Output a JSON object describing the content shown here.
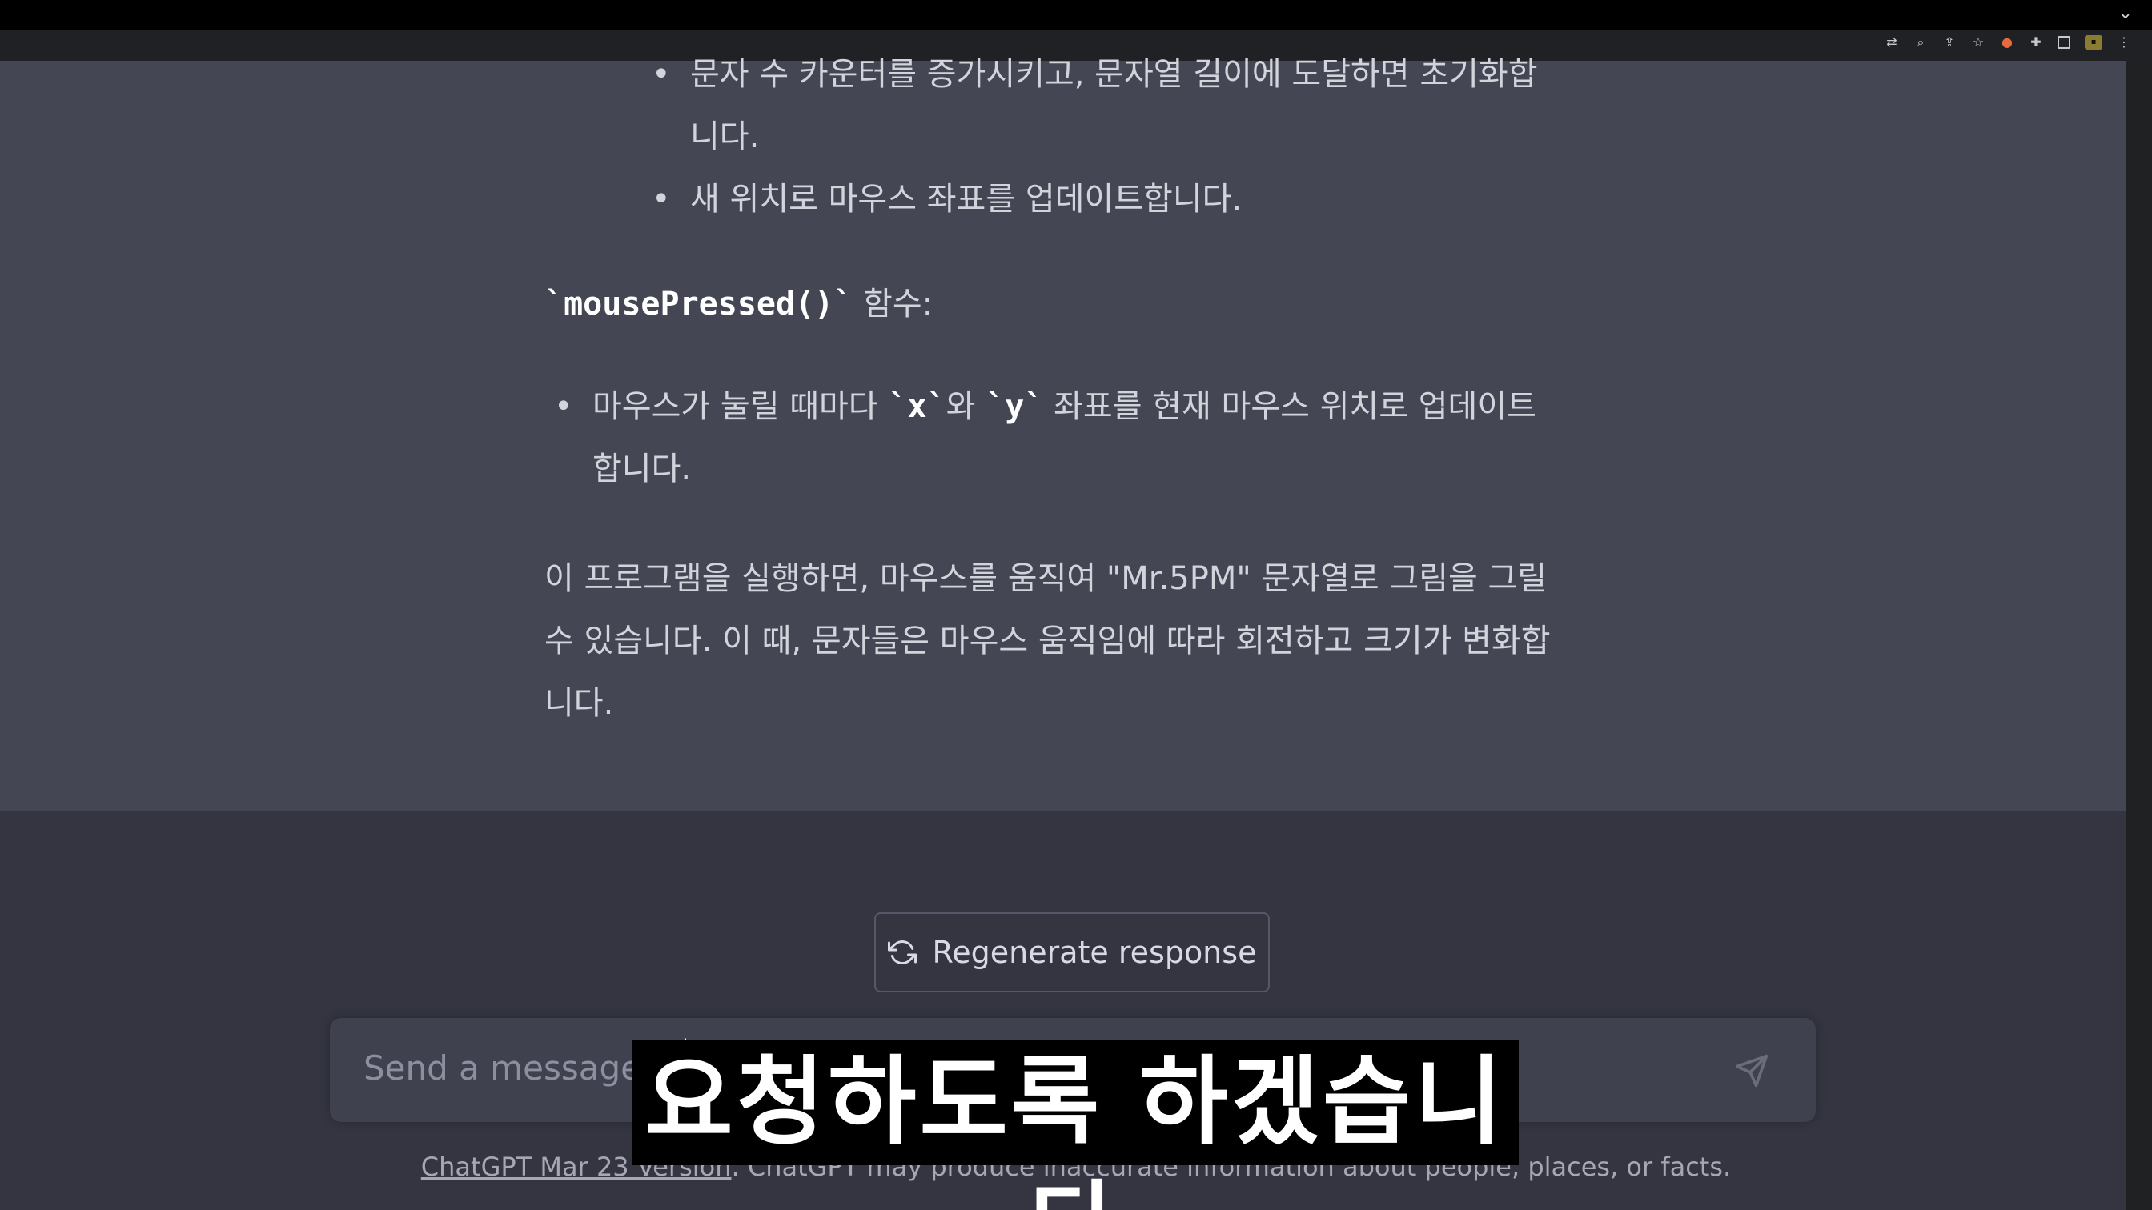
{
  "browser": {
    "menu_chevron": "⌄",
    "toolbar_icons": [
      "translate-icon",
      "zoom-icon",
      "share-icon",
      "bookmark-star-icon",
      "extension-orange-icon",
      "puzzle-extensions-icon",
      "sidepanel-icon",
      "profile-badge-icon",
      "menu-kebab-icon"
    ]
  },
  "assistant_message": {
    "list_a": [
      "문자 수 카운터를 증가시키고, 문자열 길이에 도달하면 초기화합니다.",
      "새 위치로 마우스 좌표를 업데이트합니다."
    ],
    "heading_code": "`mousePressed()`",
    "heading_suffix": " 함수:",
    "list_c": {
      "text1": "마우스가 눌릴 때마다 ",
      "code_x": "`x`",
      "text2": "와 ",
      "code_y": "`y`",
      "text3": " 좌표를 현재 마우스 위치로 업데이트합니다."
    },
    "paragraph": "이 프로그램을 실행하면, 마우스를 움직여 \"Mr.5PM\" 문자열로 그림을 그릴 수 있습니다. 이 때, 문자들은 마우스 움직임에 따라 회전하고 크기가 변화합니다."
  },
  "regenerate": {
    "label": "Regenerate response"
  },
  "composer": {
    "placeholder": "Send a message."
  },
  "footer": {
    "link": "ChatGPT Mar 23 Version",
    "text": ". ChatGPT may produce inaccurate information about people, places, or facts."
  },
  "subtitle": {
    "text": "요청하도록 하겠습니다"
  },
  "colors": {
    "message_bg": "#444654",
    "page_bg": "#343541",
    "input_bg": "#40414f",
    "text": "#d1d5db"
  }
}
